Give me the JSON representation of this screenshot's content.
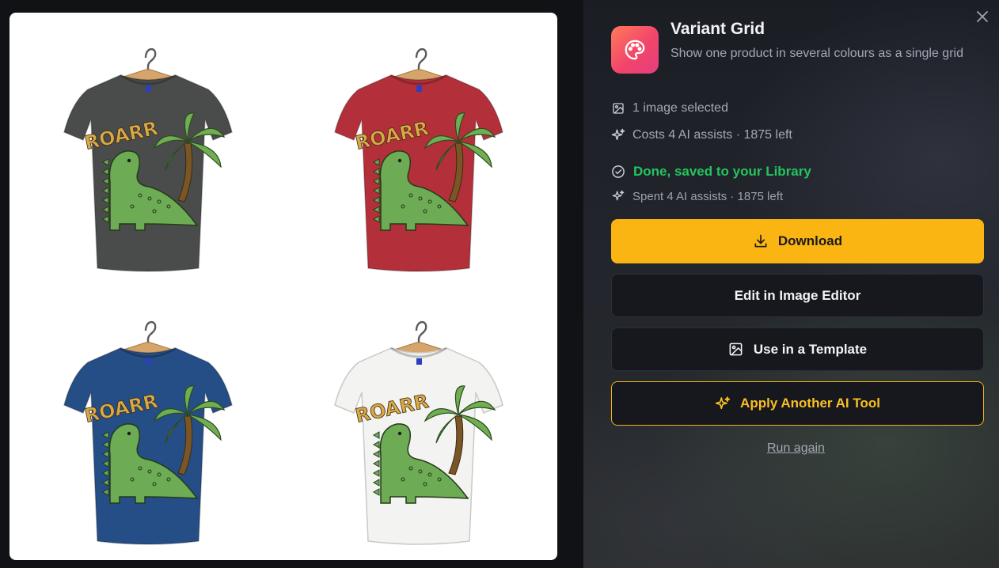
{
  "preview": {
    "shirts": [
      {
        "color": "#4a4c4b",
        "print_text": "ROARR"
      },
      {
        "color": "#b3303a",
        "print_text": "ROARR"
      },
      {
        "color": "#244e85",
        "print_text": "ROARR"
      },
      {
        "color": "#f3f3f1",
        "print_text": "ROARR"
      }
    ],
    "dino_color": "#6dab55",
    "text_color": "#d9a847"
  },
  "panel": {
    "title": "Variant Grid",
    "description": "Show one product in several colours as a single grid",
    "tool_icon": "palette-icon",
    "selected_text": "1 image selected",
    "cost_text": "Costs 4 AI assists · 1875 left",
    "done_text": "Done, saved to your Library",
    "spent_text": "Spent 4 AI assists · 1875 left",
    "download_label": "Download",
    "edit_label": "Edit in Image Editor",
    "template_label": "Use in a Template",
    "apply_label": "Apply Another AI Tool",
    "run_again_label": "Run again"
  },
  "colors": {
    "accent": "#fbb513",
    "success": "#22c55e",
    "icon_gradient_start": "#ff7a59",
    "icon_gradient_end": "#e53e7e"
  }
}
